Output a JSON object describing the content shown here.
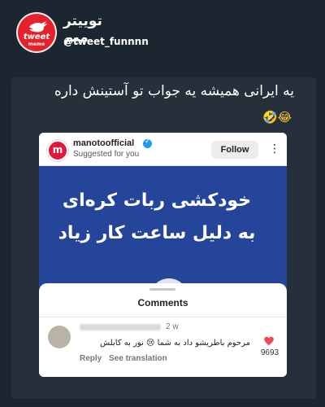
{
  "header": {
    "logo_line1": "tweet",
    "logo_line2": "meme",
    "title": "توییتر میم",
    "handle": "@tweet_funnnn"
  },
  "tweet": {
    "text": "یه ایرانی همیشه یه جواب تو آستینش داره",
    "emojis": "🤣😂"
  },
  "post": {
    "account": "manotoofficial",
    "subtitle": "Suggested for you",
    "follow_label": "Follow",
    "more_icon": "more-vertical-icon",
    "headline_line1": "خودکشی ربات کره‌ای",
    "headline_line2": "به دلیل ساعت کار زیاد"
  },
  "comments": {
    "title": "Comments",
    "time": "2 w",
    "text": "مرحوم باطریشو داد به شما 😢 نور به کابلش",
    "reply_label": "Reply",
    "translate_label": "See translation",
    "likes": "9693"
  },
  "colors": {
    "background": "#1b2630",
    "brand_red": "#e6212b",
    "post_blue": "#25459b",
    "like_red": "#ed4956"
  }
}
